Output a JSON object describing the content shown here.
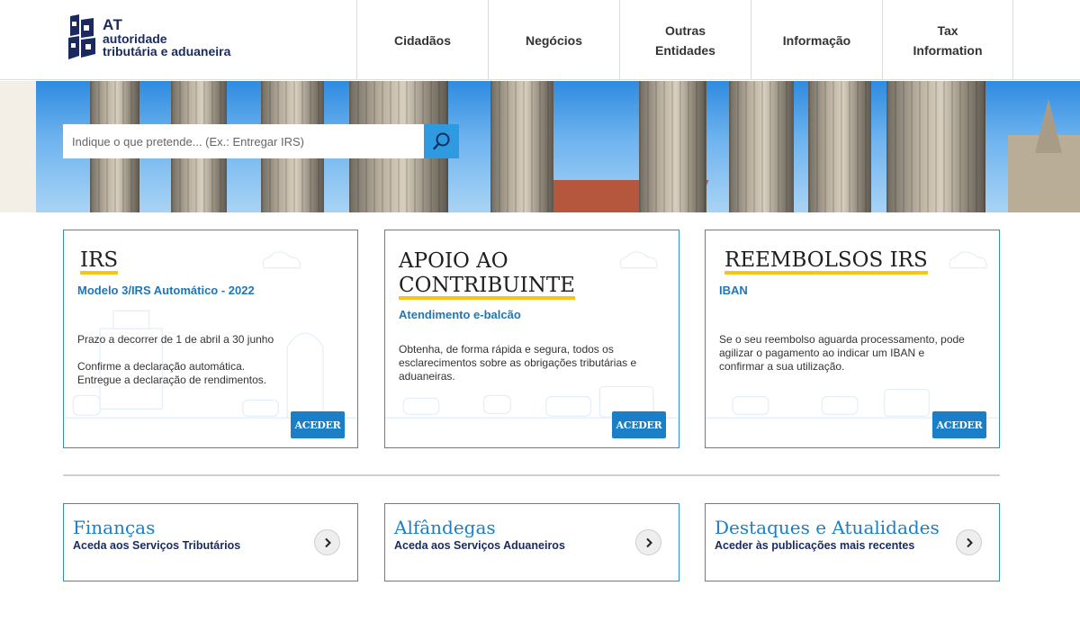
{
  "header": {
    "logo": {
      "abbr": "AT",
      "line1": "autoridade",
      "line2": "tributária e aduaneira"
    },
    "nav": [
      {
        "label": "Cidadãos"
      },
      {
        "label": "Negócios"
      },
      {
        "label": "Outras\nEntidades"
      },
      {
        "label": "Informação"
      },
      {
        "label": "Tax\nInformation"
      }
    ]
  },
  "search": {
    "placeholder": "Indique o que pretende... (Ex.: Entregar IRS)",
    "value": "",
    "icon": "search-icon"
  },
  "cards": [
    {
      "title": "IRS",
      "subtitle": "Modelo 3/IRS Automático - 2022",
      "body": [
        "Prazo a decorrer de 1 de abril a 30 junho",
        "Confirme a declaração automática.",
        "Entregue a declaração de rendimentos."
      ],
      "button": "ACEDER"
    },
    {
      "title_line1": "APOIO AO",
      "title_line2": "CONTRIBUINTE",
      "subtitle": "Atendimento e-balcão",
      "body": [
        "Obtenha, de forma rápida e segura, todos os",
        "esclarecimentos sobre as obrigações tributárias e",
        "aduaneiras."
      ],
      "button": "ACEDER"
    },
    {
      "title": "REEMBOLSOS IRS",
      "subtitle": "IBAN",
      "body": [
        "Se o seu reembolso aguarda processamento, pode",
        "agilizar o pagamento ao indicar um IBAN e",
        "confirmar a sua utilização."
      ],
      "button": "ACEDER"
    }
  ],
  "links": [
    {
      "title": "Finanças",
      "subtitle": "Aceda aos Serviços Tributários",
      "icon": "chevron-right-icon"
    },
    {
      "title": "Alfândegas",
      "subtitle": "Aceda aos Serviços Aduaneiros",
      "icon": "chevron-right-icon"
    },
    {
      "title": "Destaques e Atualidades",
      "subtitle": "Aceder às publicações mais recentes",
      "icon": "chevron-right-icon"
    }
  ],
  "colors": {
    "primary_blue": "#1a7fc7",
    "accent_yellow": "#f5c518",
    "dark_navy": "#1a2a5e"
  }
}
